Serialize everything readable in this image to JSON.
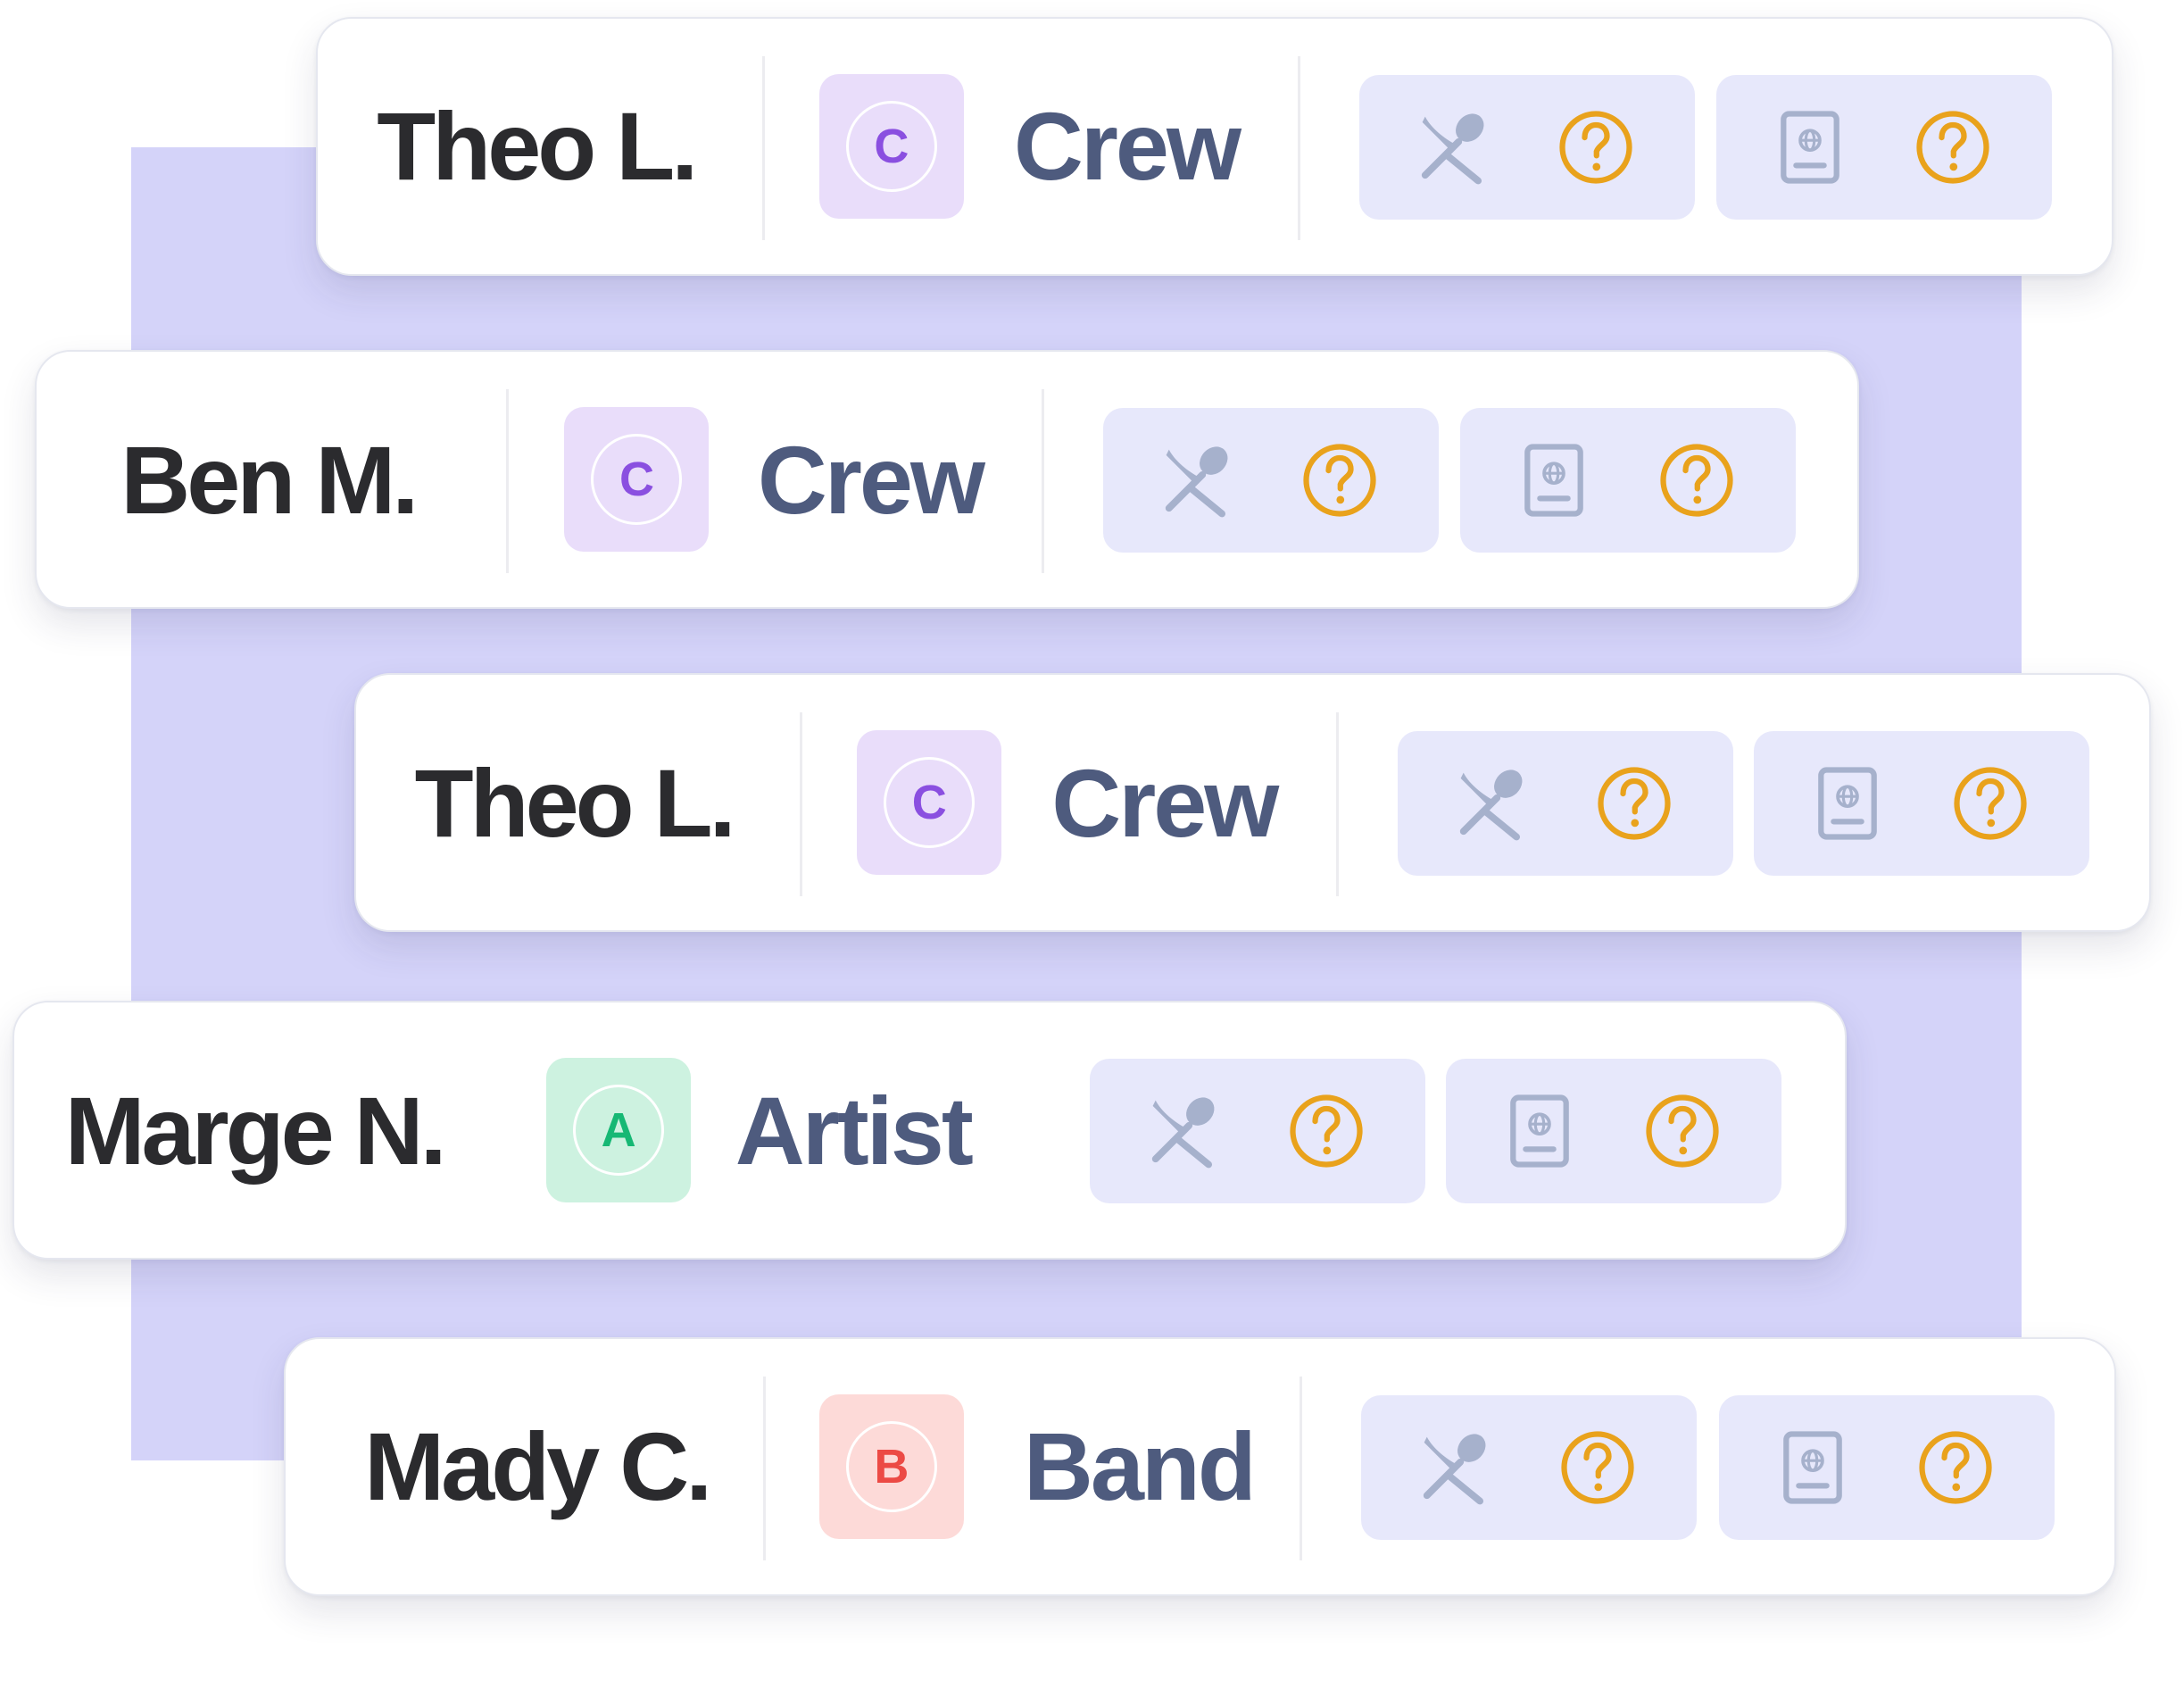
{
  "colors": {
    "backdrop": "#d4d3f9",
    "status_box_bg": "#e7e8fb",
    "icon_gray": "#a6b1cc",
    "question_orange": "#e9a21c"
  },
  "roles": {
    "crew": {
      "letter": "C",
      "label": "Crew",
      "bg": "#e9ddfa",
      "fg": "#8a4fe0"
    },
    "artist": {
      "letter": "A",
      "label": "Artist",
      "bg": "#cdf2e0",
      "fg": "#16b874"
    },
    "band": {
      "letter": "B",
      "label": "Band",
      "bg": "#fddad8",
      "fg": "#ec4a45"
    }
  },
  "rows": [
    {
      "name": "Theo L.",
      "role": "crew",
      "status_icons": [
        "meal-icon",
        "question-icon",
        "passport-icon",
        "question-icon"
      ]
    },
    {
      "name": "Ben M.",
      "role": "crew",
      "status_icons": [
        "meal-icon",
        "question-icon",
        "passport-icon",
        "question-icon"
      ]
    },
    {
      "name": "Theo L.",
      "role": "crew",
      "status_icons": [
        "meal-icon",
        "question-icon",
        "passport-icon",
        "question-icon"
      ]
    },
    {
      "name": "Marge N.",
      "role": "artist",
      "status_icons": [
        "meal-icon",
        "question-icon",
        "passport-icon",
        "question-icon"
      ]
    },
    {
      "name": "Mady C.",
      "role": "band",
      "status_icons": [
        "meal-icon",
        "question-icon",
        "passport-icon",
        "question-icon"
      ]
    }
  ]
}
